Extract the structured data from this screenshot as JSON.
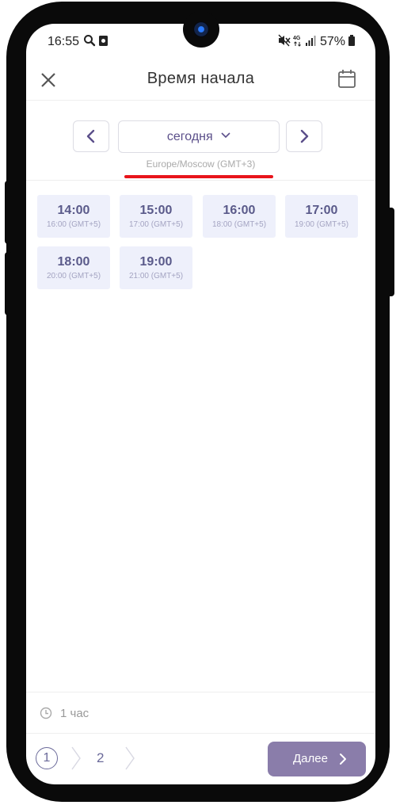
{
  "status_bar": {
    "time": "16:55",
    "battery_percent": "57%",
    "icons": [
      "search-icon",
      "notification-icon",
      "mute-icon",
      "network-4g-icon",
      "signal-icon",
      "battery-icon"
    ]
  },
  "header": {
    "title": "Время начала",
    "close_icon": "close-icon",
    "calendar_icon": "calendar-icon"
  },
  "date_nav": {
    "prev_icon": "chevron-left-icon",
    "next_icon": "chevron-right-icon",
    "selected_date": "сегодня",
    "timezone": "Europe/Moscow (GMT+3)"
  },
  "slots": [
    {
      "time": "14:00",
      "local": "16:00 (GMT+5)"
    },
    {
      "time": "15:00",
      "local": "17:00 (GMT+5)"
    },
    {
      "time": "16:00",
      "local": "18:00 (GMT+5)"
    },
    {
      "time": "17:00",
      "local": "19:00 (GMT+5)"
    },
    {
      "time": "18:00",
      "local": "20:00 (GMT+5)"
    },
    {
      "time": "19:00",
      "local": "21:00 (GMT+5)"
    }
  ],
  "footer": {
    "duration": "1 час",
    "steps": [
      "1",
      "2"
    ],
    "next_label": "Далее"
  },
  "colors": {
    "accent": "#8a7daa",
    "slot_bg": "#eef0fb",
    "slot_text": "#5a5a8a",
    "highlight_underline": "#e8141b"
  }
}
